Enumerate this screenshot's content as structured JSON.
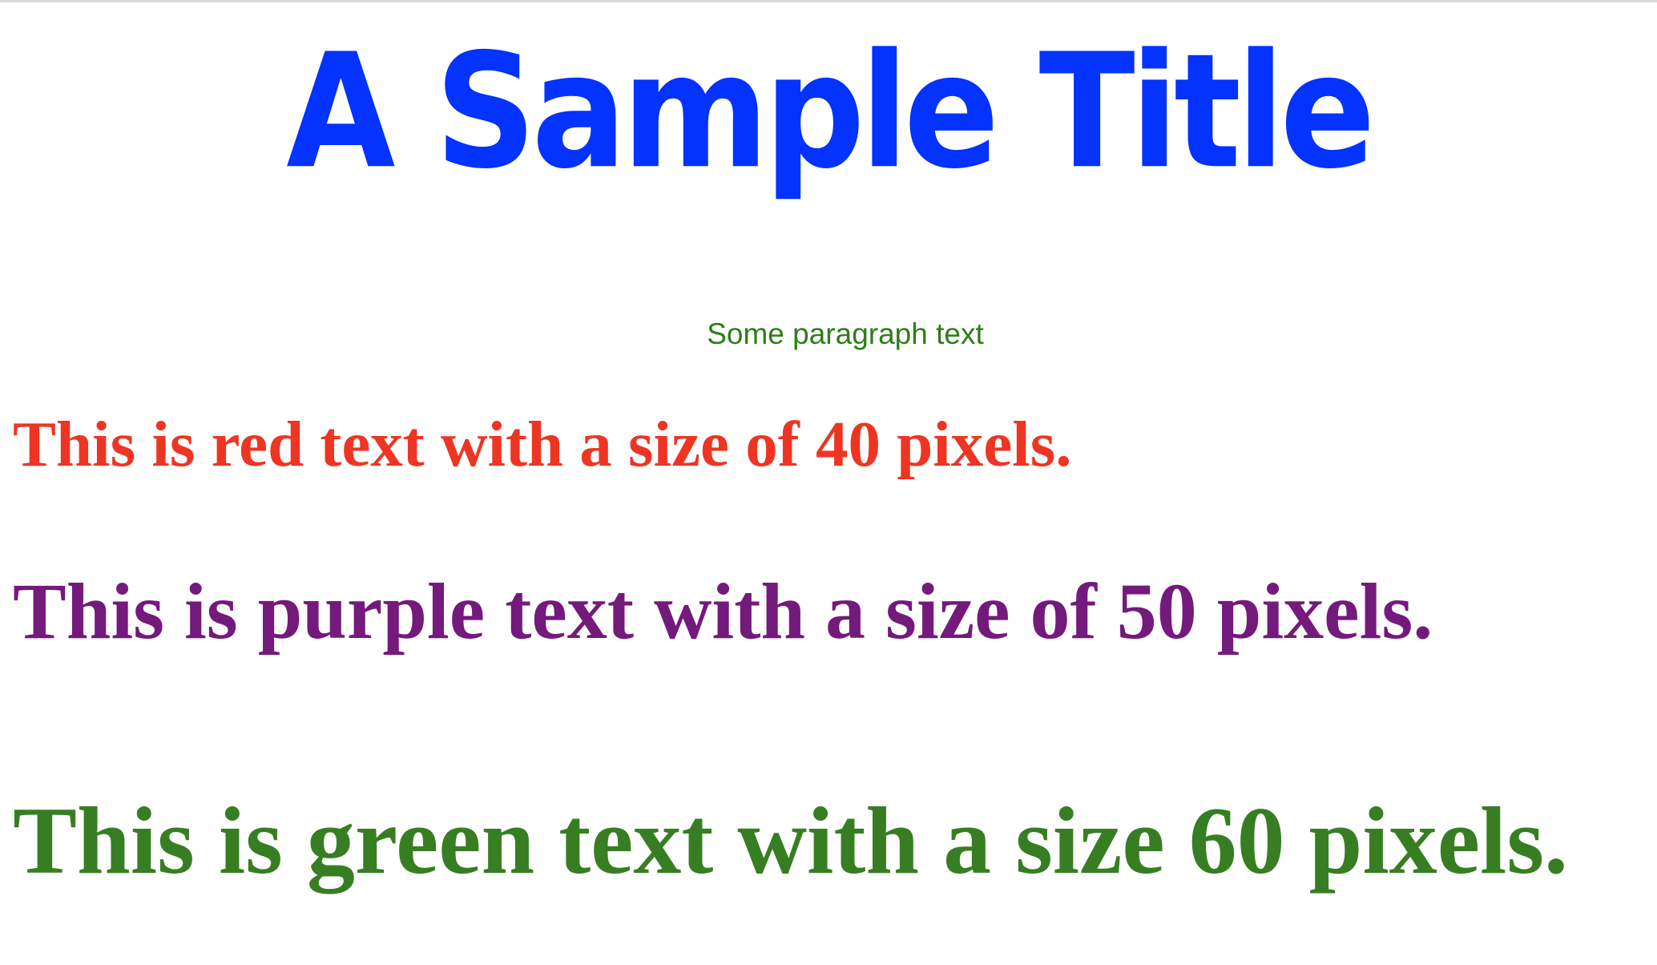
{
  "title": {
    "text": "A Sample Title",
    "color": "#0432ff"
  },
  "paragraph": {
    "text": "Some paragraph text",
    "color": "#2e7d1a"
  },
  "lines": [
    {
      "text": "This is red text with a size of 40 pixels.",
      "color": "#ee3523"
    },
    {
      "text": "This is purple text with a size of 50 pixels.",
      "color": "#741a7c"
    },
    {
      "text": "This is green text with a size 60 pixels.",
      "color": "#377e22"
    }
  ]
}
